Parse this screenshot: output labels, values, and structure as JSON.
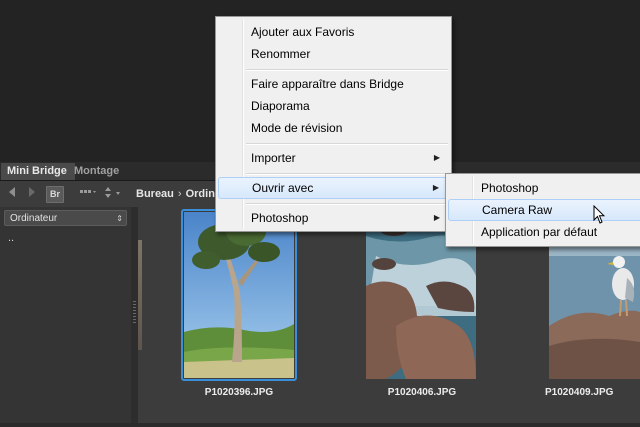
{
  "panel": {
    "tabs": [
      {
        "label": "Mini Bridge",
        "active": true
      },
      {
        "label": "Montage",
        "active": false
      }
    ],
    "toolbar": {
      "back_icon": "back-arrow-icon",
      "forward_icon": "forward-arrow-icon",
      "bridge_button": "Br",
      "view_icon": "view-options-icon",
      "sort_icon": "sort-icon",
      "breadcrumb": [
        "Bureau",
        "Ordin"
      ]
    },
    "sidebar": {
      "location_select": "Ordinateur",
      "parent_item": ".."
    },
    "thumbnails": [
      {
        "filename": "P1020396.JPG",
        "selected": true
      },
      {
        "filename": "P1020406.JPG",
        "selected": false
      },
      {
        "filename": "P1020409.JPG",
        "selected": false
      }
    ]
  },
  "context_menu": {
    "items": [
      {
        "label": "Ajouter aux Favoris"
      },
      {
        "label": "Renommer"
      },
      {
        "label": "Faire apparaître dans Bridge"
      },
      {
        "label": "Diaporama"
      },
      {
        "label": "Mode de révision"
      },
      {
        "label": "Importer",
        "has_submenu": true
      },
      {
        "label": "Ouvrir avec",
        "has_submenu": true,
        "highlighted": true
      },
      {
        "label": "Photoshop",
        "has_submenu": true
      }
    ],
    "submenu": {
      "items": [
        {
          "label": "Photoshop"
        },
        {
          "label": "Camera Raw",
          "highlighted": true
        },
        {
          "label": "Application par défaut"
        }
      ]
    }
  },
  "colors": {
    "selection_border": "#3b8fd8",
    "menu_background": "#f0f0f0",
    "panel_background": "#3c3c3c"
  }
}
